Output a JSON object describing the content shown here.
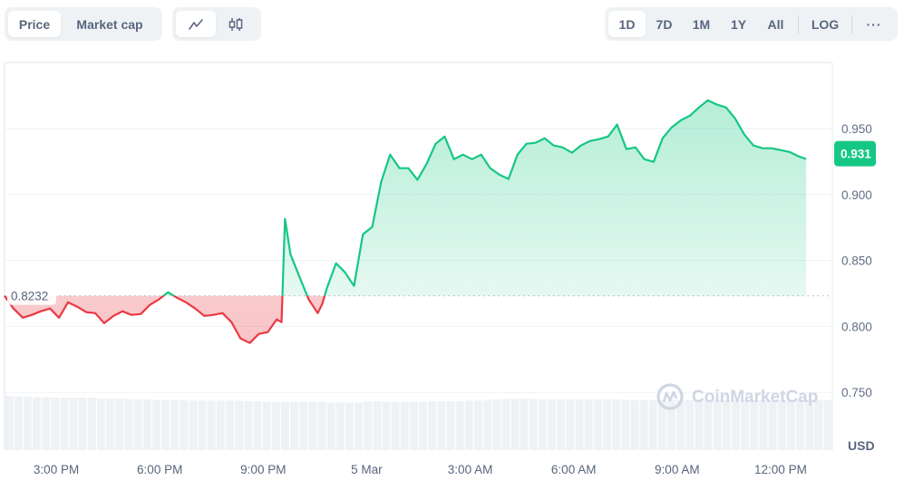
{
  "toolbar": {
    "type_tabs": [
      {
        "label": "Price",
        "active": true
      },
      {
        "label": "Market cap",
        "active": false
      }
    ],
    "style_tabs": [
      {
        "icon": "line-chart-icon",
        "active": true
      },
      {
        "icon": "candlestick-icon",
        "active": false
      }
    ],
    "range_tabs": [
      {
        "label": "1D",
        "active": true
      },
      {
        "label": "7D",
        "active": false
      },
      {
        "label": "1M",
        "active": false
      },
      {
        "label": "1Y",
        "active": false
      },
      {
        "label": "All",
        "active": false
      }
    ],
    "log_label": "LOG",
    "more_label": "···"
  },
  "colors": {
    "up": "#16c784",
    "down": "#ea3943",
    "grid": "#eff2f5",
    "volume": "#eff2f5",
    "text": "#58667e"
  },
  "watermark": "CoinMarketCap",
  "chart_data": {
    "type": "area",
    "title": "",
    "xlabel": "",
    "ylabel": "USD",
    "currency_label": "USD",
    "ylim": [
      0.74,
      0.99
    ],
    "yticks": [
      0.75,
      0.8,
      0.85,
      0.9,
      0.95
    ],
    "ytick_labels": [
      "0.750",
      "0.800",
      "0.850",
      "0.900",
      "0.950"
    ],
    "x_range_hours": [
      -1.5,
      22.5
    ],
    "xticks": [
      0,
      3,
      6,
      9,
      12,
      15,
      18,
      21
    ],
    "xtick_labels": [
      "3:00 PM",
      "6:00 PM",
      "9:00 PM",
      "5 Mar",
      "3:00 AM",
      "6:00 AM",
      "9:00 AM",
      "12:00 PM"
    ],
    "baseline": 0.8232,
    "baseline_label": "0.8232",
    "current_value": 0.931,
    "current_label": "0.931",
    "grid": true,
    "series": [
      {
        "name": "Price",
        "x_hours": [
          -1.5,
          -1.24,
          -0.97,
          -0.71,
          -0.45,
          -0.18,
          0.08,
          0.34,
          0.61,
          0.87,
          1.13,
          1.39,
          1.66,
          1.92,
          2.18,
          2.45,
          2.71,
          2.97,
          3.24,
          3.5,
          3.76,
          4.03,
          4.29,
          4.55,
          4.82,
          5.08,
          5.34,
          5.61,
          5.87,
          6.13,
          6.39,
          6.53,
          6.63,
          6.79,
          7.05,
          7.32,
          7.58,
          7.71,
          7.84,
          8.11,
          8.37,
          8.63,
          8.89,
          9.16,
          9.42,
          9.68,
          9.95,
          10.21,
          10.47,
          10.74,
          11.0,
          11.26,
          11.53,
          11.79,
          12.05,
          12.32,
          12.58,
          12.84,
          13.11,
          13.37,
          13.63,
          13.89,
          14.16,
          14.42,
          14.68,
          14.95,
          15.21,
          15.47,
          15.74,
          16.0,
          16.26,
          16.53,
          16.79,
          17.05,
          17.32,
          17.58,
          17.84,
          18.11,
          18.37,
          18.63,
          18.89,
          19.16,
          19.42,
          19.68,
          19.95,
          20.21,
          20.47,
          20.74,
          21.0,
          21.26,
          21.53,
          21.74
        ],
        "values": [
          0.8232,
          0.8135,
          0.8066,
          0.8087,
          0.8115,
          0.8135,
          0.8066,
          0.8183,
          0.8149,
          0.8108,
          0.8101,
          0.8025,
          0.808,
          0.8115,
          0.8087,
          0.8094,
          0.8163,
          0.8204,
          0.8259,
          0.8218,
          0.8183,
          0.8135,
          0.808,
          0.8087,
          0.8101,
          0.8032,
          0.7909,
          0.7874,
          0.7943,
          0.7957,
          0.8053,
          0.8032,
          0.8815,
          0.8547,
          0.8376,
          0.8204,
          0.8101,
          0.817,
          0.8286,
          0.8479,
          0.841,
          0.8307,
          0.8699,
          0.8754,
          0.9097,
          0.9303,
          0.92,
          0.92,
          0.9111,
          0.9234,
          0.9385,
          0.944,
          0.9268,
          0.9303,
          0.9268,
          0.9303,
          0.92,
          0.9152,
          0.9118,
          0.9303,
          0.9385,
          0.9392,
          0.9427,
          0.9372,
          0.9358,
          0.9317,
          0.9372,
          0.9406,
          0.942,
          0.944,
          0.953,
          0.9344,
          0.9358,
          0.9268,
          0.9248,
          0.9427,
          0.9509,
          0.9564,
          0.9598,
          0.966,
          0.9715,
          0.9681,
          0.966,
          0.9577,
          0.9454,
          0.9372,
          0.9351,
          0.9351,
          0.9337,
          0.9323,
          0.9289,
          0.9269,
          0.9248,
          0.9269,
          0.931
        ]
      }
    ],
    "volume_relative": [
      0.93,
      0.92,
      0.92,
      0.91,
      0.91,
      0.9,
      0.9,
      0.9,
      0.9,
      0.9,
      0.89,
      0.89,
      0.89,
      0.88,
      0.87,
      0.87,
      0.86,
      0.86,
      0.86,
      0.86,
      0.85,
      0.85,
      0.85,
      0.85,
      0.85,
      0.85,
      0.84,
      0.84,
      0.83,
      0.83,
      0.83,
      0.83,
      0.83,
      0.83,
      0.83,
      0.82,
      0.82,
      0.82,
      0.82,
      0.84,
      0.84,
      0.83,
      0.83,
      0.83,
      0.83,
      0.83,
      0.84,
      0.84,
      0.84,
      0.84,
      0.85,
      0.85,
      0.86,
      0.87,
      0.88,
      0.88,
      0.88,
      0.88,
      0.87,
      0.87,
      0.87,
      0.87,
      0.87,
      0.87,
      0.87,
      0.87,
      0.87,
      0.86,
      0.86,
      0.86,
      0.86,
      0.86,
      0.86,
      0.86,
      0.86,
      0.86,
      0.86,
      0.86,
      0.86,
      0.86,
      0.86,
      0.86,
      0.86,
      0.86,
      0.86,
      0.86,
      0.86,
      0.86,
      0.86,
      0.86
    ]
  }
}
